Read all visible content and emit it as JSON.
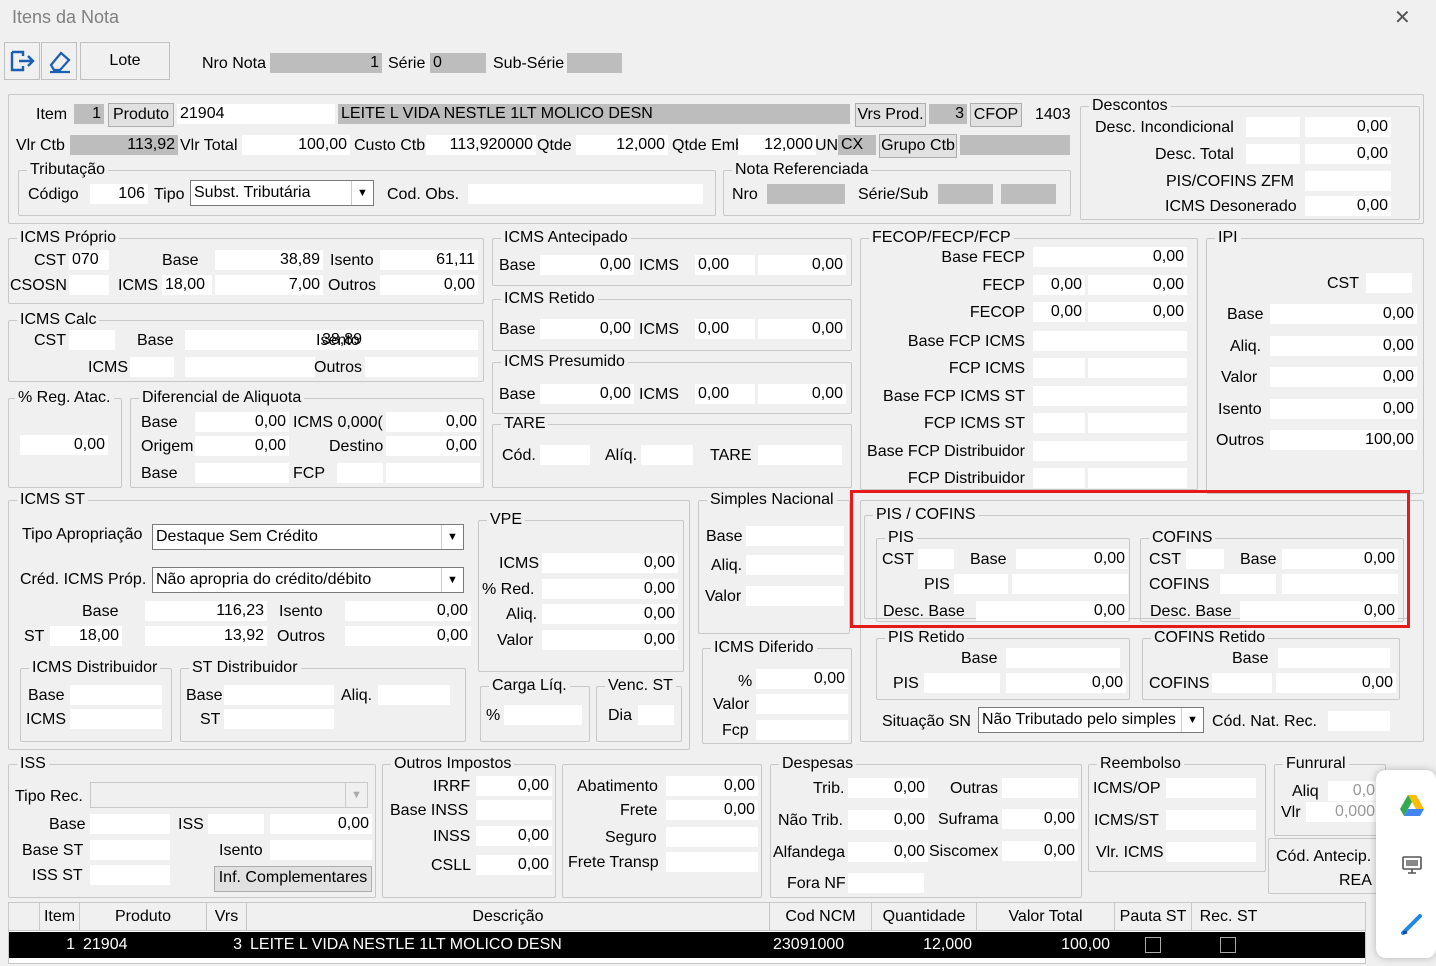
{
  "window": {
    "title": "Itens da Nota",
    "close": "✕"
  },
  "toolbar": {
    "lote": "Lote",
    "nro_nota_label": "Nro Nota",
    "nro_nota": "1",
    "serie_label": "Série",
    "serie": "0",
    "subserie_label": "Sub-Série",
    "subserie": ""
  },
  "item": {
    "item_label": "Item",
    "item": "1",
    "produto_btn": "Produto",
    "produto_code": "21904",
    "descricao": "LEITE L VIDA NESTLE 1LT MOLICO DESN",
    "vrs_prod_btn": "Vrs Prod.",
    "vrs": "3",
    "cfop_btn": "CFOP",
    "cfop": "1403",
    "vlr_ctb_label": "Vlr Ctb",
    "vlr_ctb": "113,92",
    "vlr_total_label": "Vlr Total",
    "vlr_total": "100,00",
    "custo_ctb_label": "Custo Ctb",
    "custo_ctb": "113,920000",
    "qtde_label": "Qtde",
    "qtde": "12,000",
    "qtde_emb_label": "Qtde Emb",
    "qtde_emb": "12,000",
    "un_label": "UN",
    "un": "CX",
    "grupo_ctb_btn": "Grupo Ctb"
  },
  "tributacao": {
    "title": "Tributação",
    "codigo_label": "Código",
    "codigo": "106",
    "tipo_label": "Tipo",
    "tipo": "Subst. Tributária",
    "cod_obs_label": "Cod. Obs."
  },
  "nota_ref": {
    "title": "Nota Referenciada",
    "nro_label": "Nro",
    "serie_sub_label": "Série/Sub"
  },
  "descontos": {
    "title": "Descontos",
    "incond_label": "Desc. Incondicional",
    "incond": "0,00",
    "total_label": "Desc. Total",
    "total": "0,00",
    "pis_label": "PIS/COFINS ZFM",
    "icms_deson_label": "ICMS Desonerado",
    "icms_deson": "0,00"
  },
  "icms_proprio": {
    "title": "ICMS Próprio",
    "cst_label": "CST",
    "cst": "070",
    "base_label": "Base",
    "base": "38,89",
    "isento_label": "Isento",
    "isento": "61,11",
    "csosn_label": "CSOSN",
    "icms_label": "ICMS",
    "icms_rate": "18,00",
    "icms_val": "7,00",
    "outros_label": "Outros",
    "outros": "0,00"
  },
  "icms_calc": {
    "title": "ICMS Calc",
    "cst_label": "CST",
    "base_label": "Base",
    "base": "38,89",
    "isento_label": "Isento",
    "icms_label": "ICMS",
    "outros_label": "Outros"
  },
  "icms_antecipado": {
    "title": "ICMS Antecipado",
    "base_label": "Base",
    "base": "0,00",
    "icms_label": "ICMS",
    "icms_rate": "0,00",
    "icms_val": "0,00"
  },
  "icms_retido": {
    "title": "ICMS Retido",
    "base_label": "Base",
    "base": "0,00",
    "icms_label": "ICMS",
    "icms_rate": "0,00",
    "icms_val": "0,00"
  },
  "icms_presumido": {
    "title": "ICMS Presumido",
    "base_label": "Base",
    "base": "0,00",
    "icms_label": "ICMS",
    "icms_rate": "0,00",
    "icms_val": "0,00"
  },
  "tare": {
    "title": "TARE",
    "cod_label": "Cód.",
    "aliq_label": "Alíq.",
    "tare_label": "TARE"
  },
  "reg_atac": {
    "title": "% Reg. Atac.",
    "value": "0,00"
  },
  "dif_aliq": {
    "title": "Diferencial de Aliquota",
    "base_label": "Base",
    "base": "0,00",
    "icms_label": "ICMS 0,000(",
    "icms_val": "0,00",
    "origem_label": "Origem",
    "origem": "0,00",
    "destino_label": "Destino",
    "destino": "0,00",
    "base2_label": "Base",
    "fcp_label": "FCP"
  },
  "fecop": {
    "title": "FECOP/FECP/FCP",
    "base_fecp_label": "Base FECP",
    "base_fecp": "0,00",
    "fecp_label": "FECP",
    "fecp_rate": "0,00",
    "fecp_val": "0,00",
    "fecop_label": "FECOP",
    "fecop_rate": "0,00",
    "fecop_val": "0,00",
    "base_fcp_icms_label": "Base FCP ICMS",
    "fcp_icms_label": "FCP ICMS",
    "base_fcp_icms_st_label": "Base FCP ICMS ST",
    "fcp_icms_st_label": "FCP ICMS ST",
    "base_fcp_dist_label": "Base FCP Distribuidor",
    "fcp_dist_label": "FCP Distribuidor"
  },
  "ipi": {
    "title": "IPI",
    "cst_label": "CST",
    "base_label": "Base",
    "base": "0,00",
    "aliq_label": "Aliq.",
    "aliq": "0,00",
    "valor_label": "Valor",
    "valor": "0,00",
    "isento_label": "Isento",
    "isento": "0,00",
    "outros_label": "Outros",
    "outros": "100,00"
  },
  "icms_st": {
    "title": "ICMS ST",
    "tipo_aprop_label": "Tipo Apropriação",
    "tipo_aprop": "Destaque Sem Crédito",
    "cred_label": "Créd. ICMS Próp.",
    "cred": "Não apropria do crédito/débito",
    "base_label": "Base",
    "base": "116,23",
    "isento_label": "Isento",
    "isento": "0,00",
    "st_label": "ST",
    "st_rate": "18,00",
    "st_val": "13,92",
    "outros_label": "Outros",
    "outros": "0,00"
  },
  "icms_dist": {
    "title": "ICMS Distribuidor",
    "base_label": "Base",
    "icms_label": "ICMS"
  },
  "st_dist": {
    "title": "ST Distribuidor",
    "base_label": "Base",
    "aliq_label": "Aliq.",
    "st_label": "ST"
  },
  "vpe": {
    "title": "VPE",
    "icms_label": "ICMS",
    "icms": "0,00",
    "red_label": "% Red.",
    "red": "0,00",
    "aliq_label": "Aliq.",
    "aliq": "0,00",
    "valor_label": "Valor",
    "valor": "0,00"
  },
  "carga": {
    "title": "Carga Líq.",
    "pct_label": "%"
  },
  "venc_st": {
    "title": "Venc. ST",
    "dia_label": "Dia"
  },
  "simples": {
    "title": "Simples Nacional",
    "base_label": "Base",
    "aliq_label": "Aliq.",
    "valor_label": "Valor"
  },
  "icms_dif": {
    "title": "ICMS Diferido",
    "pct_label": "%",
    "pct": "0,00",
    "valor_label": "Valor",
    "fcp_label": "Fcp"
  },
  "pis_cofins": {
    "title": "PIS / COFINS",
    "highlight": "#e51b1b",
    "pis": {
      "title": "PIS",
      "cst_label": "CST",
      "base_label": "Base",
      "base": "0,00",
      "pis_label": "PIS",
      "desc_label": "Desc. Base",
      "desc": "0,00"
    },
    "cofins": {
      "title": "COFINS",
      "cst_label": "CST",
      "base_label": "Base",
      "base": "0,00",
      "cofins_label": "COFINS",
      "desc_label": "Desc. Base",
      "desc": "0,00"
    }
  },
  "pis_retido": {
    "title": "PIS Retido",
    "base_label": "Base",
    "pis_label": "PIS",
    "pis": "0,00"
  },
  "cofins_retido": {
    "title": "COFINS Retido",
    "base_label": "Base",
    "cofins_label": "COFINS",
    "cofins": "0,00"
  },
  "situacao": {
    "label": "Situação SN",
    "value": "Não Tributado pelo simples",
    "cod_nat_label": "Cód. Nat. Rec."
  },
  "iss": {
    "title": "ISS",
    "tipo_rec_label": "Tipo Rec.",
    "base_label": "Base",
    "iss_label": "ISS",
    "iss": "0,00",
    "base_st_label": "Base ST",
    "isento_label": "Isento",
    "iss_st_label": "ISS ST",
    "inf_btn": "Inf. Complementares"
  },
  "outros_imp": {
    "title": "Outros Impostos",
    "irrf_label": "IRRF",
    "irrf": "0,00",
    "base_inss_label": "Base INSS",
    "inss_label": "INSS",
    "inss": "0,00",
    "csll_label": "CSLL",
    "csll": "0,00"
  },
  "abat": {
    "abatimento_label": "Abatimento",
    "abatimento": "0,00",
    "frete_label": "Frete",
    "frete": "0,00",
    "seguro_label": "Seguro",
    "frete_transp_label": "Frete Transp"
  },
  "despesas": {
    "title": "Despesas",
    "trib_label": "Trib.",
    "trib": "0,00",
    "outras_label": "Outras",
    "nao_trib_label": "Não Trib.",
    "nao_trib": "0,00",
    "suframa_label": "Suframa",
    "suframa": "0,00",
    "alfandega_label": "Alfandega",
    "alfandega": "0,00",
    "siscomex_label": "Siscomex",
    "siscomex": "0,00",
    "fora_nf_label": "Fora NF"
  },
  "reembolso": {
    "title": "Reembolso",
    "icms_op": "ICMS/OP",
    "icms_st": "ICMS/ST",
    "vlr_icms": "Vlr. ICMS"
  },
  "funrural": {
    "title": "Funrural",
    "aliq_label": "Aliq",
    "aliq": "0,0",
    "vlr_label": "Vlr",
    "vlr": "0,000",
    "cod_antecip_label": "Cód. Antecip.",
    "rea_label": "REA"
  },
  "table": {
    "columns": [
      "Item",
      "Produto",
      "Vrs",
      "Descrição",
      "Cod NCM",
      "Quantidade",
      "Valor Total",
      "Pauta ST",
      "Rec. ST"
    ],
    "rows": [
      [
        "1",
        "21904",
        "3",
        "LEITE L VIDA NESTLE 1LT MOLICO DESN",
        "23091000",
        "12,000",
        "100,00"
      ]
    ]
  }
}
